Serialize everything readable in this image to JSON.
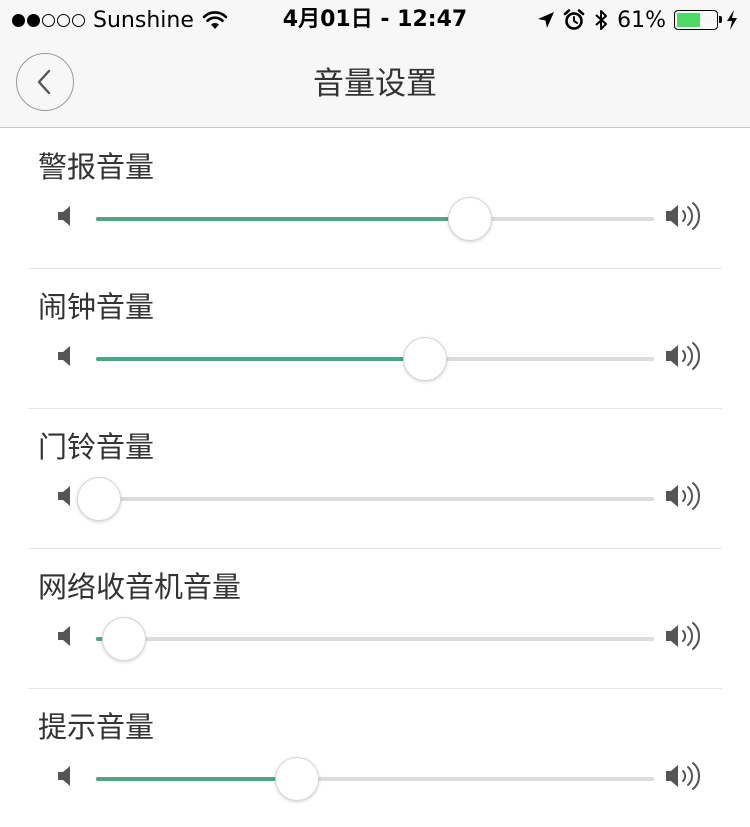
{
  "status_bar": {
    "carrier": "Sunshine",
    "signal_filled": 2,
    "signal_total": 5,
    "time": "4月01日 - 12:47",
    "battery_percent": "61%",
    "battery_level": 0.61,
    "battery_color": "#4cd964",
    "icons": [
      "wifi-icon",
      "location-arrow-icon",
      "alarm-clock-icon",
      "bluetooth-icon",
      "battery-icon",
      "charging-bolt-icon"
    ]
  },
  "nav": {
    "back_icon": "chevron-left-icon",
    "title": "音量设置"
  },
  "accent_color": "#4aa783",
  "sliders": [
    {
      "label": "警报音量",
      "value": 0.67
    },
    {
      "label": "闹钟音量",
      "value": 0.59
    },
    {
      "label": "门铃音量",
      "value": 0.005
    },
    {
      "label": "网络收音机音量",
      "value": 0.05
    },
    {
      "label": "提示音量",
      "value": 0.36
    }
  ]
}
